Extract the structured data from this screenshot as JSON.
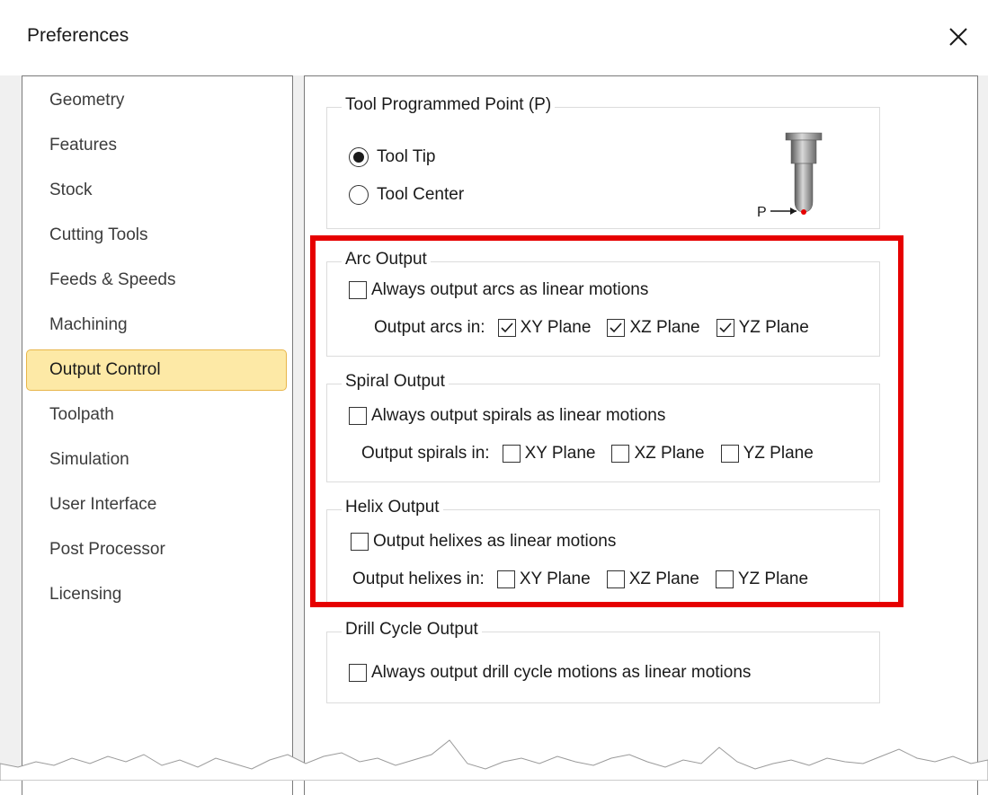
{
  "window": {
    "title": "Preferences",
    "close_icon": "close-icon"
  },
  "nav": {
    "items": [
      {
        "label": "Geometry",
        "selected": false
      },
      {
        "label": "Features",
        "selected": false
      },
      {
        "label": "Stock",
        "selected": false
      },
      {
        "label": "Cutting Tools",
        "selected": false
      },
      {
        "label": "Feeds & Speeds",
        "selected": false
      },
      {
        "label": "Machining",
        "selected": false
      },
      {
        "label": "Output Control",
        "selected": true
      },
      {
        "label": "Toolpath",
        "selected": false
      },
      {
        "label": "Simulation",
        "selected": false
      },
      {
        "label": "User Interface",
        "selected": false
      },
      {
        "label": "Post Processor",
        "selected": false
      },
      {
        "label": "Licensing",
        "selected": false
      }
    ]
  },
  "tool_point": {
    "title": "Tool Programmed Point (P)",
    "option_tip": "Tool Tip",
    "option_center": "Tool Center",
    "selected": "Tool Tip",
    "diagram_label": "P"
  },
  "arc_output": {
    "title": "Arc Output",
    "linear_label": "Always output arcs as linear motions",
    "linear_checked": false,
    "planes_label": "Output arcs in:",
    "xy": "XY Plane",
    "xz": "XZ Plane",
    "yz": "YZ Plane",
    "xy_checked": true,
    "xz_checked": true,
    "yz_checked": true
  },
  "spiral_output": {
    "title": "Spiral Output",
    "linear_label": "Always output spirals as linear motions",
    "linear_checked": false,
    "planes_label": "Output spirals in:",
    "xy": "XY Plane",
    "xz": "XZ Plane",
    "yz": "YZ Plane",
    "xy_checked": false,
    "xz_checked": false,
    "yz_checked": false
  },
  "helix_output": {
    "title": "Helix Output",
    "linear_label": "Output helixes as linear motions",
    "linear_checked": false,
    "planes_label": "Output helixes in:",
    "xy": "XY Plane",
    "xz": "XZ Plane",
    "yz": "YZ Plane",
    "xy_checked": false,
    "xz_checked": false,
    "yz_checked": false
  },
  "drill_output": {
    "title": "Drill Cycle Output",
    "linear_label": "Always output drill cycle motions as linear motions",
    "linear_checked": false
  },
  "colors": {
    "highlight": "#e60000",
    "selected_bg": "#fde9a6",
    "selected_border": "#e8b64a"
  }
}
